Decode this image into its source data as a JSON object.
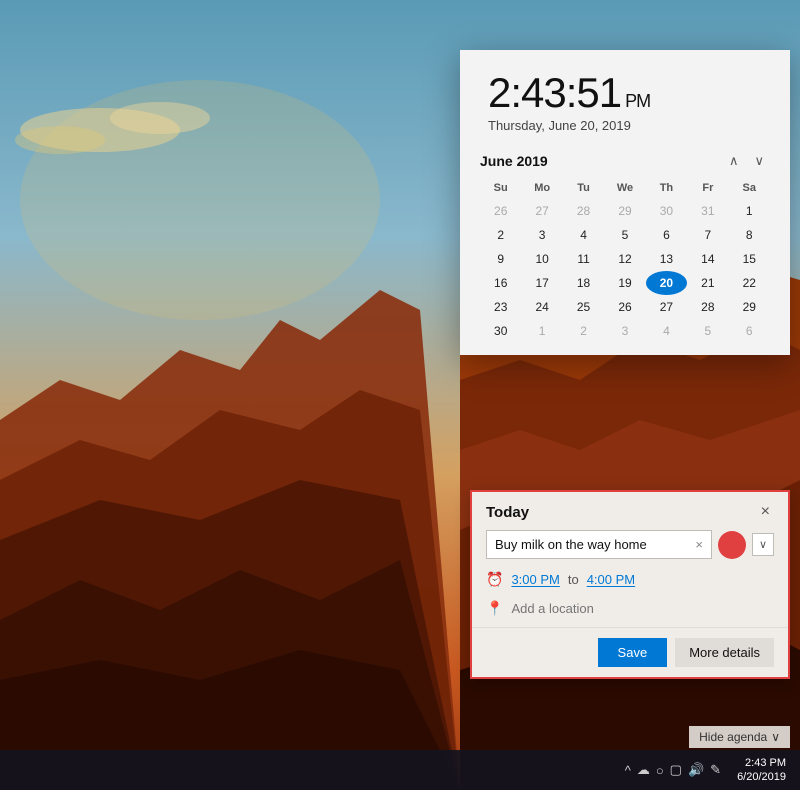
{
  "background": {
    "alt": "Grand Canyon sunset landscape"
  },
  "taskbar": {
    "time": "2:43 PM",
    "date": "6/20/2019",
    "icons": [
      "^",
      "☁",
      "○",
      "□",
      "🔊",
      "✎"
    ]
  },
  "flyout": {
    "time": "2:43:51",
    "ampm": "PM",
    "date": "Thursday, June 20, 2019",
    "calendar": {
      "month_label": "June 2019",
      "nav_up": "∧",
      "nav_down": "∨",
      "day_headers": [
        "Su",
        "Mo",
        "Tu",
        "We",
        "Th",
        "Fr",
        "Sa"
      ],
      "weeks": [
        [
          {
            "day": "26",
            "other": true
          },
          {
            "day": "27",
            "other": true
          },
          {
            "day": "28",
            "other": true
          },
          {
            "day": "29",
            "other": true
          },
          {
            "day": "30",
            "other": true
          },
          {
            "day": "31",
            "other": true
          },
          {
            "day": "1",
            "other": false
          }
        ],
        [
          {
            "day": "2",
            "other": false
          },
          {
            "day": "3",
            "other": false
          },
          {
            "day": "4",
            "other": false
          },
          {
            "day": "5",
            "other": false
          },
          {
            "day": "6",
            "other": false
          },
          {
            "day": "7",
            "other": false
          },
          {
            "day": "8",
            "other": false
          }
        ],
        [
          {
            "day": "9",
            "other": false
          },
          {
            "day": "10",
            "other": false
          },
          {
            "day": "11",
            "other": false
          },
          {
            "day": "12",
            "other": false
          },
          {
            "day": "13",
            "other": false
          },
          {
            "day": "14",
            "other": false
          },
          {
            "day": "15",
            "other": false
          }
        ],
        [
          {
            "day": "16",
            "other": false
          },
          {
            "day": "17",
            "other": false
          },
          {
            "day": "18",
            "other": false
          },
          {
            "day": "19",
            "other": false
          },
          {
            "day": "20",
            "other": false,
            "today": true
          },
          {
            "day": "21",
            "other": false
          },
          {
            "day": "22",
            "other": false
          }
        ],
        [
          {
            "day": "23",
            "other": false
          },
          {
            "day": "24",
            "other": false
          },
          {
            "day": "25",
            "other": false
          },
          {
            "day": "26",
            "other": false
          },
          {
            "day": "27",
            "other": false
          },
          {
            "day": "28",
            "other": false
          },
          {
            "day": "29",
            "other": false
          }
        ],
        [
          {
            "day": "30",
            "other": false
          },
          {
            "day": "1",
            "other": true
          },
          {
            "day": "2",
            "other": true
          },
          {
            "day": "3",
            "other": true
          },
          {
            "day": "4",
            "other": true
          },
          {
            "day": "5",
            "other": true
          },
          {
            "day": "6",
            "other": true
          }
        ]
      ]
    }
  },
  "event_popup": {
    "header_title": "Today",
    "close_label": "×",
    "event_title": "Buy milk on the way home",
    "clear_label": "×",
    "color_button_title": "Red",
    "dropdown_label": "∨",
    "time_from": "3:00 PM",
    "time_to_label": "to",
    "time_to": "4:00 PM",
    "location_placeholder": "Add a location",
    "save_label": "Save",
    "more_details_label": "More details"
  },
  "hide_agenda": {
    "label": "Hide agenda",
    "icon": "∨"
  }
}
